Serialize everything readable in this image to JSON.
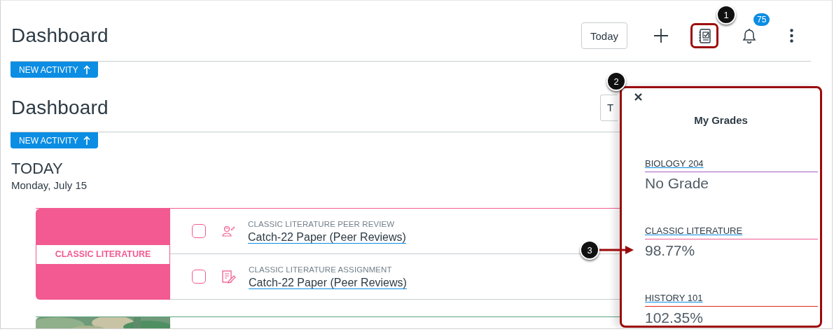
{
  "header": {
    "title": "Dashboard",
    "today_button": "Today",
    "notifications_badge": "75",
    "new_activity": "NEW ACTIVITY"
  },
  "background_header": {
    "title": "Dashboard",
    "today_button": "T",
    "new_activity": "NEW ACTIVITY"
  },
  "today": {
    "heading": "TODAY",
    "date": "Monday, July 15"
  },
  "cards": [
    {
      "kind": "course",
      "course": "CLASSIC LITERATURE",
      "color": "#f25a91",
      "items": [
        {
          "kind": "peer_review",
          "type_label": "CLASSIC LITERATURE PEER REVIEW",
          "title": "Catch-22 Paper (Peer Reviews)",
          "checked": false
        },
        {
          "kind": "assignment",
          "type_label": "CLASSIC LITERATURE ASSIGNMENT",
          "title": "Catch-22 Paper (Peer Reviews)",
          "checked": false
        }
      ]
    },
    {
      "kind": "picture",
      "color": "#5aa37e"
    }
  ],
  "grades_tray": {
    "title": "My Grades",
    "courses": [
      {
        "name": "BIOLOGY 204",
        "grade": "No Grade",
        "color": "#a65ac7"
      },
      {
        "name": "CLASSIC LITERATURE",
        "grade": "98.77%",
        "color": "#f25a91"
      },
      {
        "name": "HISTORY 101",
        "grade": "102.35%",
        "color": "#e0281c"
      }
    ]
  },
  "callouts": [
    {
      "label": "1",
      "kind": "plain"
    },
    {
      "label": "2",
      "kind": "plain"
    },
    {
      "label": "3",
      "kind": "arrow"
    }
  ]
}
